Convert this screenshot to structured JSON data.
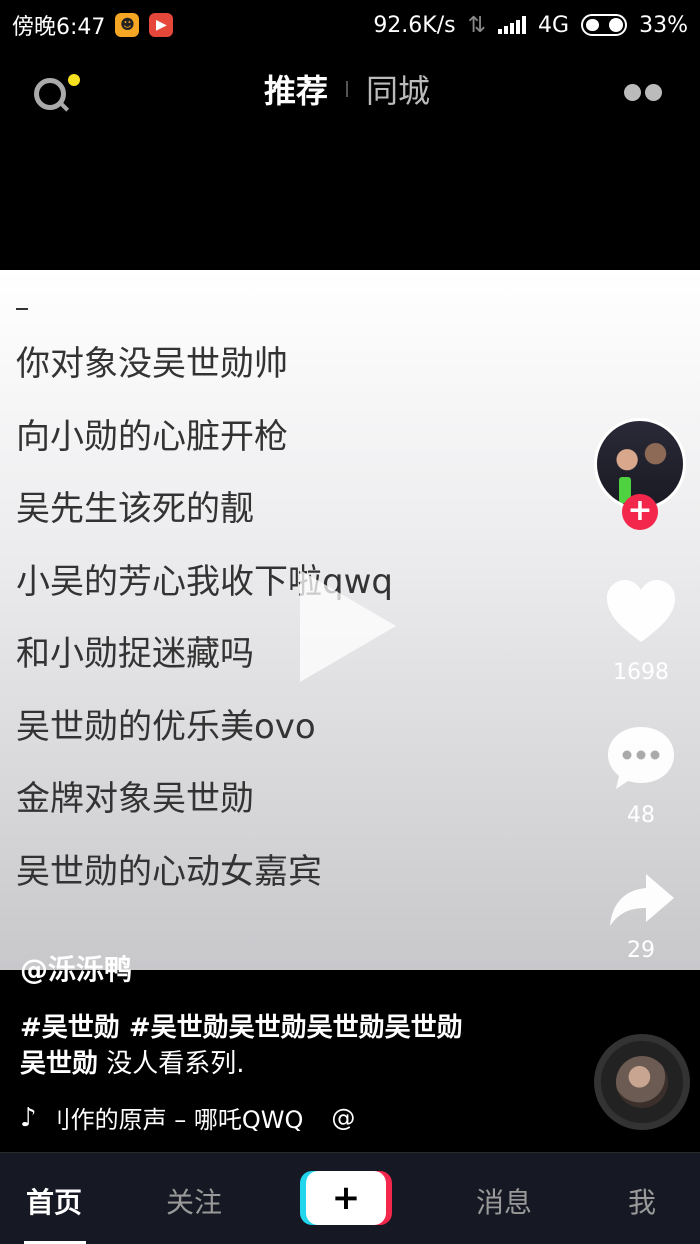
{
  "status_bar": {
    "time": "傍晚6:47",
    "net_speed": "92.6K/s",
    "network": "4G",
    "battery": "33%",
    "battery_level": 0.33
  },
  "top_nav": {
    "tab_recommend": "推荐",
    "tab_local": "同城"
  },
  "video": {
    "lyrics": [
      "你对象没吴世勋帅",
      "向小勋的心脏开枪",
      "吴先生该死的靓",
      "小吴的芳心我收下啦qwq",
      "和小勋捉迷藏吗",
      "吴世勋的优乐美ovo",
      "金牌对象吴世勋",
      "吴世勋的心动女嘉宾"
    ]
  },
  "actions": {
    "likes": "1698",
    "comments": "48",
    "shares": "29"
  },
  "caption": {
    "username": "@泺泺鸭",
    "hashtags": "#吴世勋 #吴世勋吴世勋吴世勋吴世勋",
    "desc_bold": "吴世勋",
    "desc_rest": " 没人看系列.",
    "music": "刂作的原声 – 哪吒QWQ",
    "music_tail": "@"
  },
  "bottom_nav": {
    "home": "首页",
    "follow": "关注",
    "create": "+",
    "messages": "消息",
    "me": "我"
  },
  "colors": {
    "accent_red": "#f3264c",
    "accent_cyan": "#20d5ec",
    "search_dot": "#f7e01f"
  }
}
